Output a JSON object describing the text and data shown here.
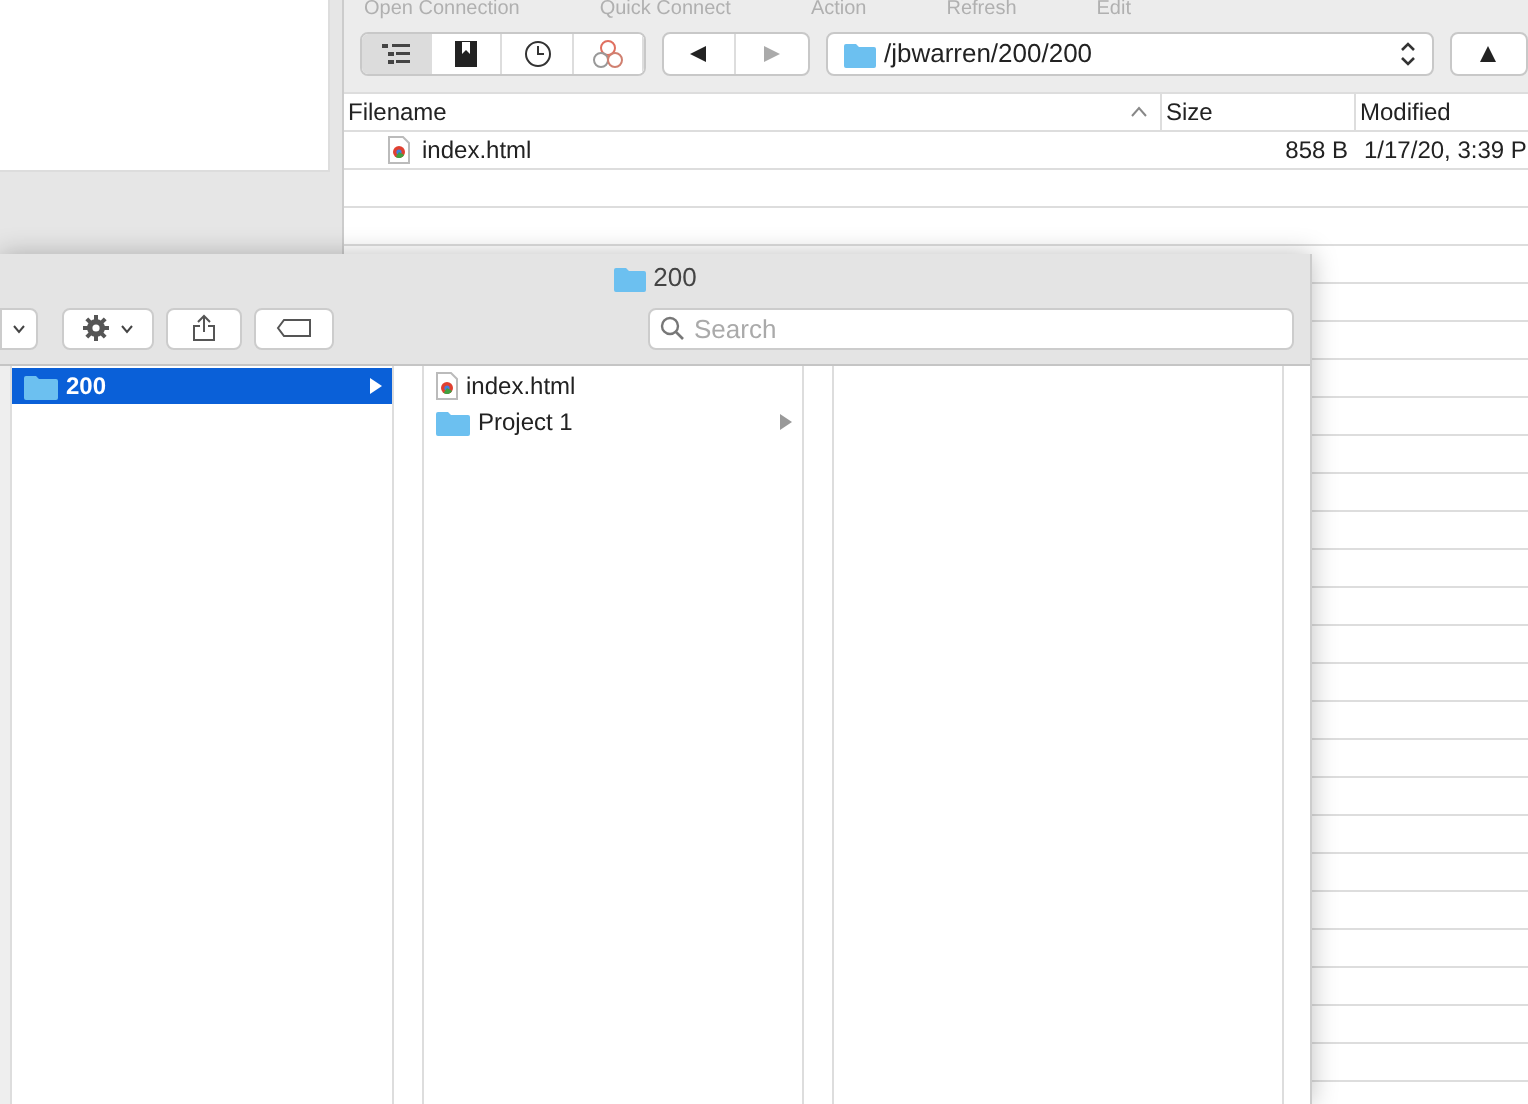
{
  "back_window": {
    "toolbar_labels": [
      "Open Connection",
      "Quick Connect",
      "Action",
      "Refresh",
      "Edit"
    ],
    "view_buttons": [
      {
        "kind": "browser",
        "selected": true
      },
      {
        "kind": "bookmarks",
        "selected": false
      },
      {
        "kind": "history",
        "selected": false
      },
      {
        "kind": "bonjour",
        "selected": false
      }
    ],
    "path": "/jbwarren/200/200",
    "columns": [
      "Filename",
      "Size",
      "Modified"
    ],
    "rows": [
      {
        "filename": "index.html",
        "size": "858 B",
        "modified": "1/17/20, 3:39 P"
      }
    ]
  },
  "finder": {
    "title": "200",
    "search": {
      "placeholder": "Search"
    },
    "columns": [
      [
        {
          "name": "200",
          "kind": "folder",
          "selected": true,
          "has_children": true
        }
      ],
      [
        {
          "name": "index.html",
          "kind": "html",
          "selected": false,
          "has_children": false
        },
        {
          "name": "Project 1",
          "kind": "folder",
          "selected": false,
          "has_children": true
        }
      ]
    ]
  }
}
